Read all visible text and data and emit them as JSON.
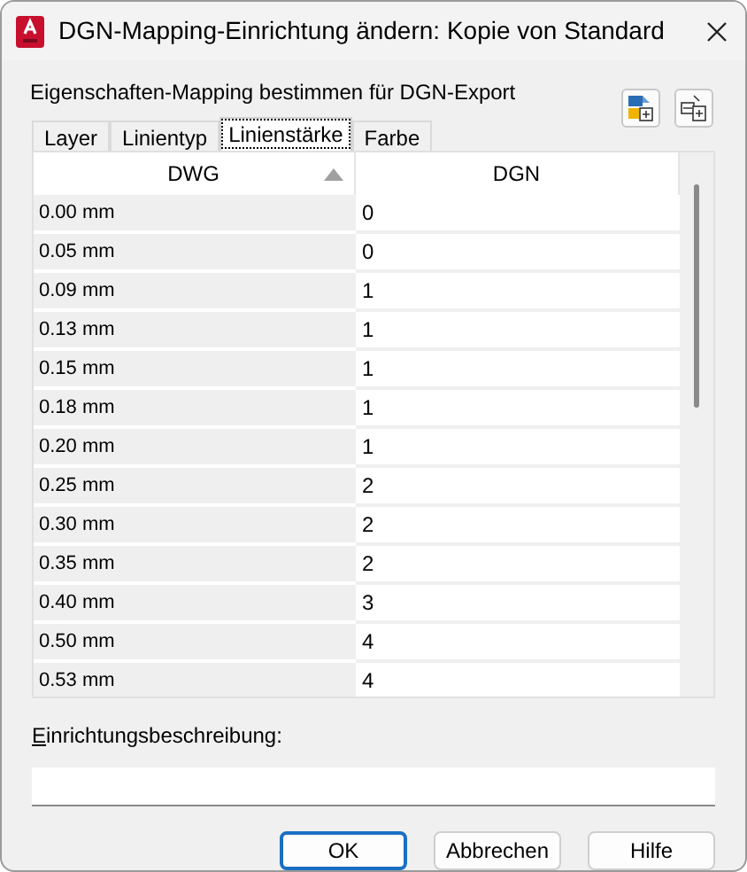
{
  "window": {
    "title": "DGN-Mapping-Einrichtung ändern: Kopie von Standard"
  },
  "heading": "Eigenschaften-Mapping bestimmen für DGN-Export",
  "tabs": [
    {
      "label": "Layer",
      "selected": false
    },
    {
      "label": "Linientyp",
      "selected": false
    },
    {
      "label": "Linienstärke",
      "selected": true
    },
    {
      "label": "Farbe",
      "selected": false
    }
  ],
  "table": {
    "columns": [
      "DWG",
      "DGN"
    ],
    "rows": [
      [
        "0.00 mm",
        "0"
      ],
      [
        "0.05 mm",
        "0"
      ],
      [
        "0.09 mm",
        "1"
      ],
      [
        "0.13 mm",
        "1"
      ],
      [
        "0.15 mm",
        "1"
      ],
      [
        "0.18 mm",
        "1"
      ],
      [
        "0.20 mm",
        "1"
      ],
      [
        "0.25 mm",
        "2"
      ],
      [
        "0.30 mm",
        "2"
      ],
      [
        "0.35 mm",
        "2"
      ],
      [
        "0.40 mm",
        "3"
      ],
      [
        "0.50 mm",
        "4"
      ],
      [
        "0.53 mm",
        "4"
      ]
    ]
  },
  "description": {
    "label": "Einrichtungsbeschreibung:"
  },
  "buttons": [
    {
      "label": "OK",
      "kind": "default"
    },
    {
      "label": "Abbrechen",
      "kind": "normal"
    },
    {
      "label": "Hilfe",
      "kind": "normal"
    }
  ]
}
